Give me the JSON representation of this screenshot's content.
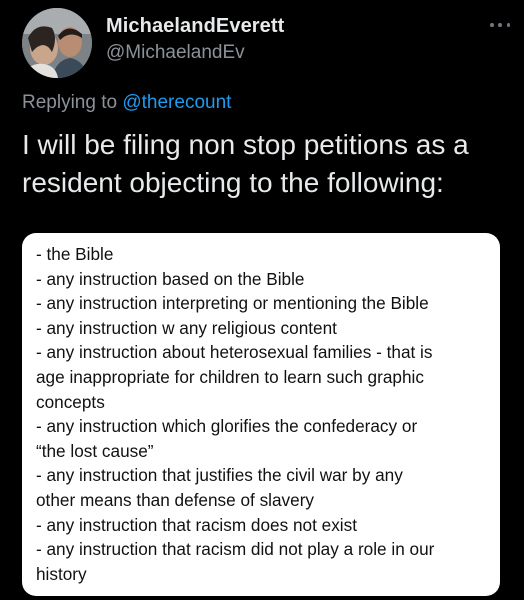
{
  "tweet": {
    "author": {
      "display_name": "MichaelandEverett",
      "handle": "@MichaelandEv"
    },
    "replying_prefix": "Replying to ",
    "replying_to": "@therecount",
    "text_lines": [
      "I will be filing non stop petitions as a",
      "resident objecting to the following:"
    ],
    "attached_note_lines": [
      "- the Bible",
      "- any instruction based on the Bible",
      "- any instruction interpreting or mentioning the Bible",
      "- any instruction w any religious content",
      "- any instruction about heterosexual families - that is",
      "age inappropriate for children to learn such graphic",
      "concepts",
      "- any instruction which glorifies the confederacy or",
      "“the lost cause”",
      "- any instruction that justifies the civil war by any",
      "other means than defense of slavery",
      "- any instruction that racism does not exist",
      "- any instruction that racism did not play a role in our",
      "history"
    ],
    "icons": {
      "more": "more-horizontal-icon",
      "avatar": "profile-photo"
    },
    "colors": {
      "background": "#000000",
      "primary_text": "#e7e9ea",
      "secondary_text": "#8b9298",
      "link": "#1d9bf0",
      "card_background": "#ffffff",
      "card_text": "#111111"
    }
  }
}
